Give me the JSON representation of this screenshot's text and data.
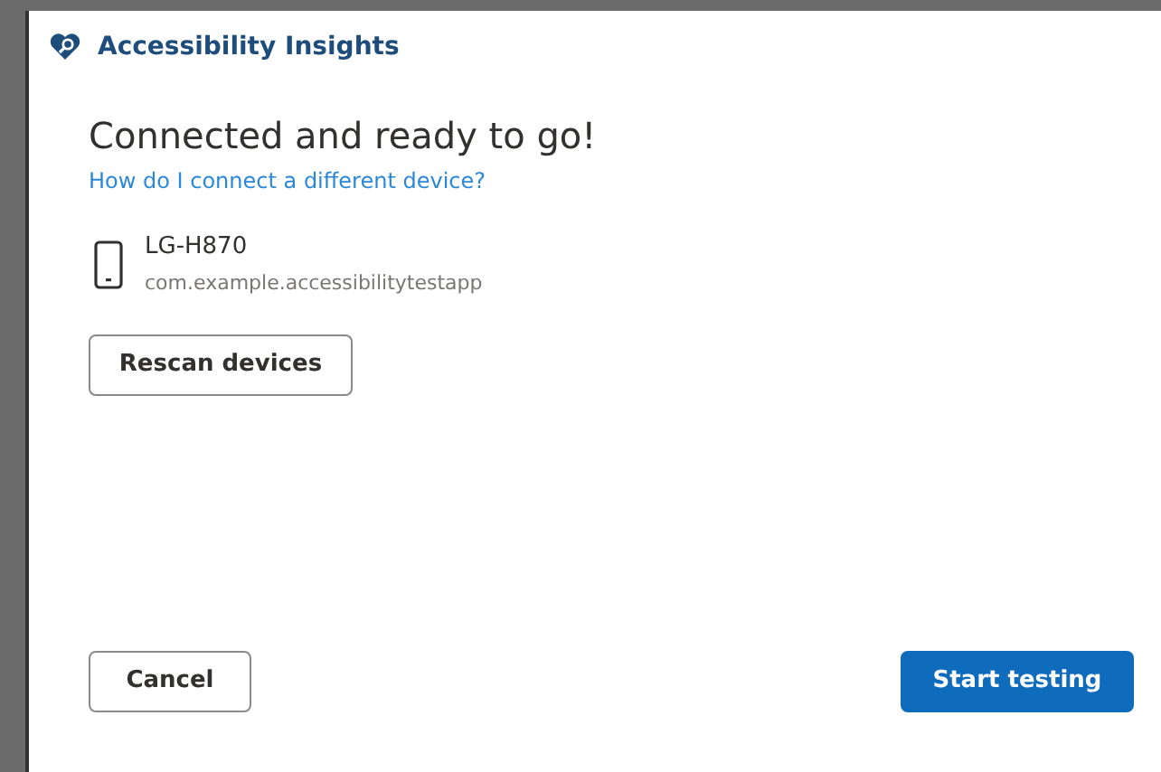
{
  "window": {
    "title": "Accessibility Insights"
  },
  "heading": "Connected and ready to go!",
  "help_link": "How do I connect a different device?",
  "device": {
    "name": "LG-H870",
    "app": "com.example.accessibilitytestapp"
  },
  "rescan_button": "Rescan devices",
  "buttons": [
    {
      "label": "Cancel",
      "kind": "secondary"
    },
    {
      "label": "Start testing",
      "kind": "primary"
    }
  ]
}
